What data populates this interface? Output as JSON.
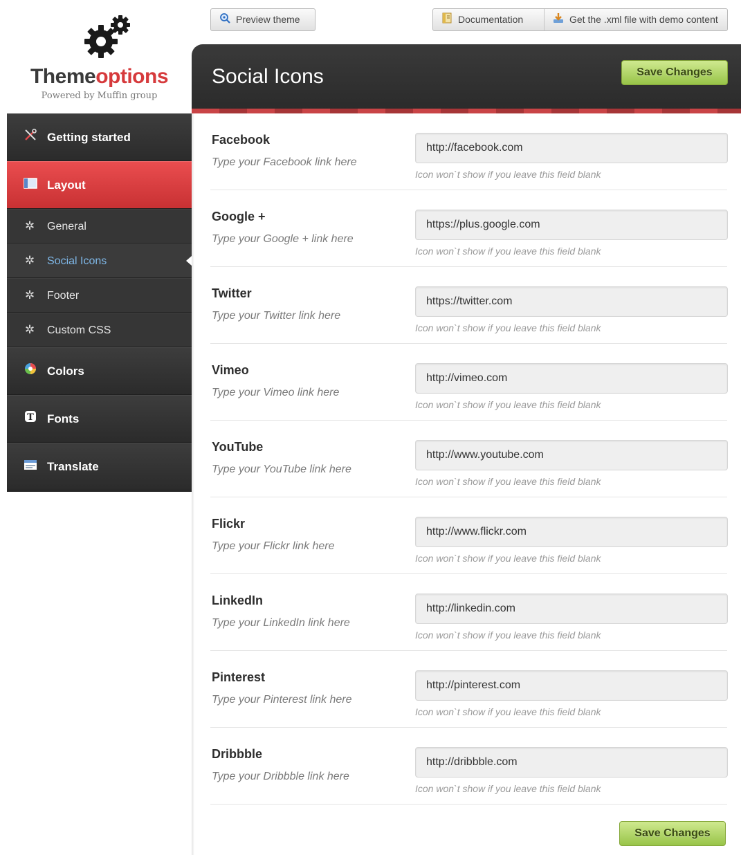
{
  "logo": {
    "brand_main": "Theme",
    "brand_accent": "options",
    "tagline": "Powered by Muffin group"
  },
  "toolbar": {
    "preview_label": "Preview theme",
    "documentation_label": "Documentation",
    "xml_label": "Get the .xml file with demo content"
  },
  "sidebar": {
    "items": [
      {
        "label": "Getting started",
        "icon": "tools-icon"
      },
      {
        "label": "Layout",
        "icon": "layout-icon",
        "active": true
      },
      {
        "label": "General",
        "icon": "gear-icon"
      },
      {
        "label": "Social Icons",
        "icon": "gear-icon",
        "active": true
      },
      {
        "label": "Footer",
        "icon": "gear-icon"
      },
      {
        "label": "Custom CSS",
        "icon": "gear-icon"
      },
      {
        "label": "Colors",
        "icon": "color-wheel-icon"
      },
      {
        "label": "Fonts",
        "icon": "font-icon"
      },
      {
        "label": "Translate",
        "icon": "translate-icon"
      }
    ]
  },
  "panel": {
    "title": "Social Icons",
    "save_label": "Save Changes",
    "save_bottom_label": "Save Changes"
  },
  "accent": "#d63a3c",
  "fields": [
    {
      "label": "Facebook",
      "desc": "Type your Facebook link here",
      "value": "http://facebook.com",
      "hint": "Icon won`t show if you leave this field blank"
    },
    {
      "label": "Google +",
      "desc": "Type your Google + link here",
      "value": "https://plus.google.com",
      "hint": "Icon won`t show if you leave this field blank"
    },
    {
      "label": "Twitter",
      "desc": "Type your Twitter link here",
      "value": "https://twitter.com",
      "hint": "Icon won`t show if you leave this field blank"
    },
    {
      "label": "Vimeo",
      "desc": "Type your Vimeo link here",
      "value": "http://vimeo.com",
      "hint": "Icon won`t show if you leave this field blank"
    },
    {
      "label": "YouTube",
      "desc": "Type your YouTube link here",
      "value": "http://www.youtube.com",
      "hint": "Icon won`t show if you leave this field blank"
    },
    {
      "label": "Flickr",
      "desc": "Type your Flickr link here",
      "value": "http://www.flickr.com",
      "hint": "Icon won`t show if you leave this field blank"
    },
    {
      "label": "LinkedIn",
      "desc": "Type your LinkedIn link here",
      "value": "http://linkedin.com",
      "hint": "Icon won`t show if you leave this field blank"
    },
    {
      "label": "Pinterest",
      "desc": "Type your Pinterest link here",
      "value": "http://pinterest.com",
      "hint": "Icon won`t show if you leave this field blank"
    },
    {
      "label": "Dribbble",
      "desc": "Type your Dribbble link here",
      "value": "http://dribbble.com",
      "hint": "Icon won`t show if you leave this field blank"
    }
  ]
}
